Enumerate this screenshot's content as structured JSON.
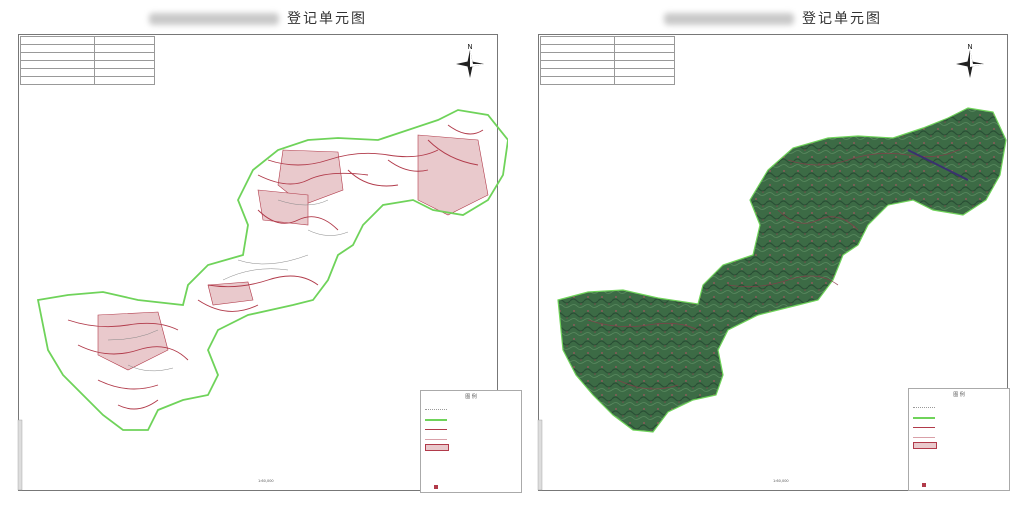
{
  "maps": [
    {
      "title": "登记单元图",
      "info_table": [
        "",
        "",
        "",
        "",
        "",
        "",
        ""
      ],
      "north_label": "N",
      "legend_title": "图 例",
      "legend_rows": 9,
      "scale": "1:60,000",
      "style": "line"
    },
    {
      "title": "登记单元图",
      "info_table": [
        "",
        "",
        "",
        "",
        "",
        "",
        ""
      ],
      "north_label": "N",
      "legend_title": "图 例",
      "legend_rows": 9,
      "scale": "1:60,000",
      "style": "satellite"
    }
  ],
  "colors": {
    "boundary": "#6fd35a",
    "roads": "#b13a4a",
    "zone_fill": "#e9c9cc",
    "forest": "#3c6b45",
    "forest_dark": "#2a4f35"
  }
}
